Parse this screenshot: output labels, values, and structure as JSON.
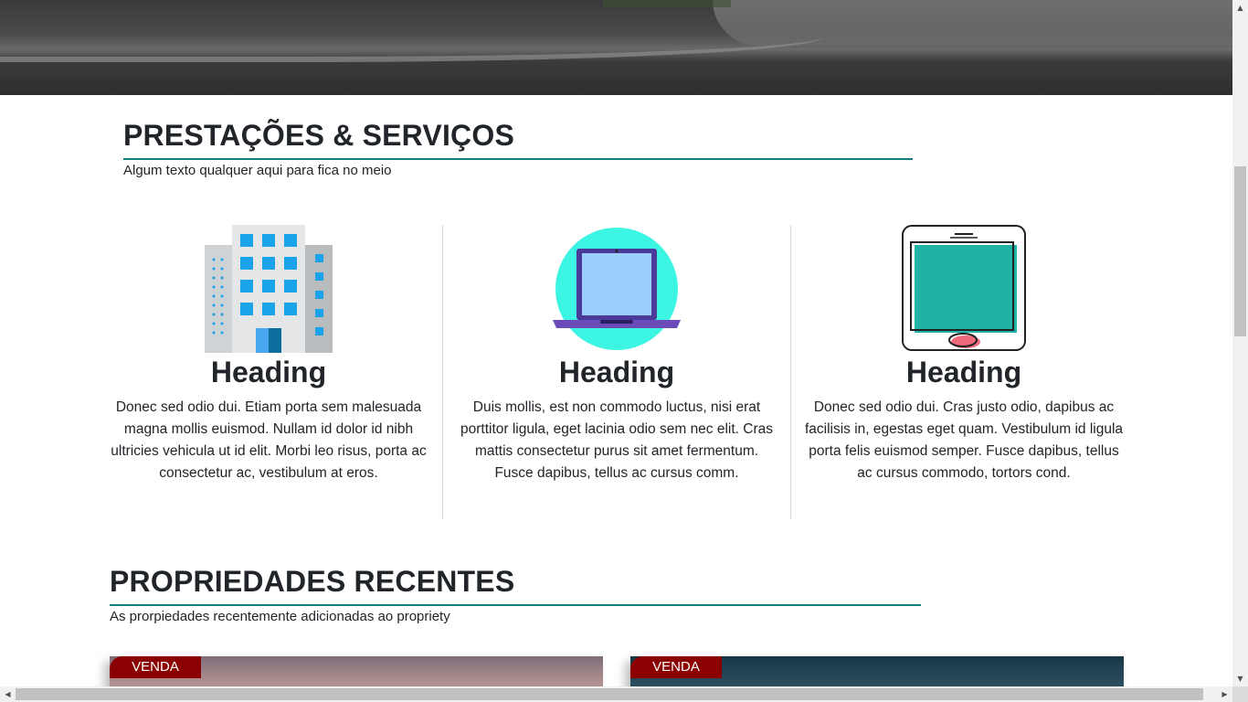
{
  "services": {
    "title": "PRESTAÇÕES & SERVIÇOS",
    "subtitle": "Algum texto qualquer aqui para fica no meio",
    "items": [
      {
        "icon": "building-icon",
        "heading": "Heading",
        "text": "Donec sed odio dui. Etiam porta sem malesuada magna mollis euismod. Nullam id dolor id nibh ultricies vehicula ut id elit. Morbi leo risus, porta ac consectetur ac, vestibulum at eros."
      },
      {
        "icon": "laptop-icon",
        "heading": "Heading",
        "text": "Duis mollis, est non commodo luctus, nisi erat porttitor ligula, eget lacinia odio sem nec elit. Cras mattis consectetur purus sit amet fermentum. Fusce dapibus, tellus ac cursus comm."
      },
      {
        "icon": "tablet-icon",
        "heading": "Heading",
        "text": "Donec sed odio dui. Cras justo odio, dapibus ac facilisis in, egestas eget quam. Vestibulum id ligula porta felis euismod semper. Fusce dapibus, tellus ac cursus commodo, tortors cond."
      }
    ]
  },
  "properties": {
    "title": "PROPRIEDADES RECENTES",
    "subtitle": "As prorpiedades recentemente adicionadas ao propriety",
    "cards": [
      {
        "badge": "VENDA"
      },
      {
        "badge": "VENDA"
      }
    ]
  },
  "colors": {
    "accent": "#167c80",
    "badge": "#8b0000"
  }
}
